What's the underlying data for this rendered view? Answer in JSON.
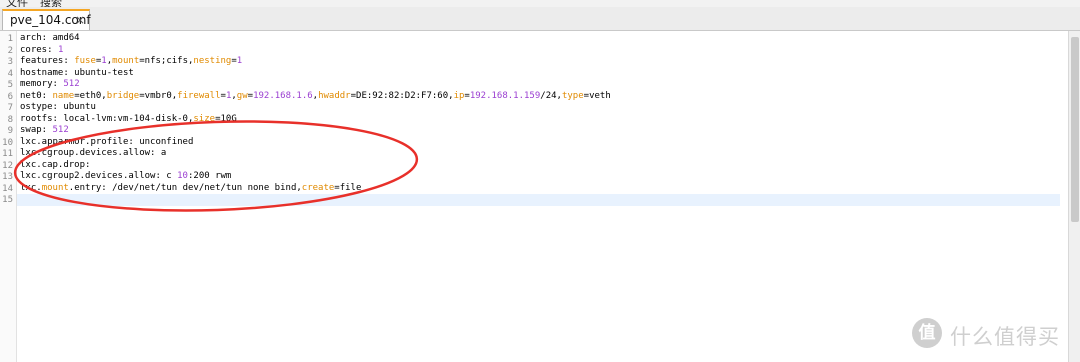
{
  "menubar": {
    "file": "文件",
    "search": "搜索"
  },
  "tab": {
    "label": "pve_104.conf",
    "close": "×"
  },
  "editor": {
    "lines": [
      {
        "n": "1",
        "segs": [
          {
            "t": "arch: amd64",
            "c": "p"
          }
        ]
      },
      {
        "n": "2",
        "segs": [
          {
            "t": "cores: ",
            "c": "p"
          },
          {
            "t": "1",
            "c": "n"
          }
        ]
      },
      {
        "n": "3",
        "segs": [
          {
            "t": "features: ",
            "c": "p"
          },
          {
            "t": "fuse",
            "c": "k"
          },
          {
            "t": "=",
            "c": "p"
          },
          {
            "t": "1",
            "c": "n"
          },
          {
            "t": ",",
            "c": "p"
          },
          {
            "t": "mount",
            "c": "k"
          },
          {
            "t": "=nfs;cifs,",
            "c": "p"
          },
          {
            "t": "nesting",
            "c": "k"
          },
          {
            "t": "=",
            "c": "p"
          },
          {
            "t": "1",
            "c": "n"
          }
        ]
      },
      {
        "n": "4",
        "segs": [
          {
            "t": "hostname: ubuntu-test",
            "c": "p"
          }
        ]
      },
      {
        "n": "5",
        "segs": [
          {
            "t": "memory: ",
            "c": "p"
          },
          {
            "t": "512",
            "c": "n"
          }
        ]
      },
      {
        "n": "6",
        "segs": [
          {
            "t": "net0: ",
            "c": "p"
          },
          {
            "t": "name",
            "c": "k"
          },
          {
            "t": "=eth0,",
            "c": "p"
          },
          {
            "t": "bridge",
            "c": "k"
          },
          {
            "t": "=vmbr0,",
            "c": "p"
          },
          {
            "t": "firewall",
            "c": "k"
          },
          {
            "t": "=",
            "c": "p"
          },
          {
            "t": "1",
            "c": "n"
          },
          {
            "t": ",",
            "c": "p"
          },
          {
            "t": "gw",
            "c": "k"
          },
          {
            "t": "=",
            "c": "p"
          },
          {
            "t": "192.168.1.6",
            "c": "n"
          },
          {
            "t": ",",
            "c": "p"
          },
          {
            "t": "hwaddr",
            "c": "k"
          },
          {
            "t": "=DE:92:82:D2:F7:60,",
            "c": "p"
          },
          {
            "t": "ip",
            "c": "k"
          },
          {
            "t": "=",
            "c": "p"
          },
          {
            "t": "192.168.1.159",
            "c": "n"
          },
          {
            "t": "/24,",
            "c": "p"
          },
          {
            "t": "type",
            "c": "k"
          },
          {
            "t": "=veth",
            "c": "p"
          }
        ]
      },
      {
        "n": "7",
        "segs": [
          {
            "t": "ostype: ubuntu",
            "c": "p"
          }
        ]
      },
      {
        "n": "8",
        "segs": [
          {
            "t": "rootfs: local-lvm:vm-104-disk-0,",
            "c": "p"
          },
          {
            "t": "size",
            "c": "k"
          },
          {
            "t": "=10G",
            "c": "p"
          }
        ]
      },
      {
        "n": "9",
        "segs": [
          {
            "t": "swap: ",
            "c": "p"
          },
          {
            "t": "512",
            "c": "n"
          }
        ]
      },
      {
        "n": "10",
        "segs": [
          {
            "t": "lxc.apparmor.profile: unconfined",
            "c": "p"
          }
        ]
      },
      {
        "n": "11",
        "segs": [
          {
            "t": "lxc.cgroup.devices.allow: a",
            "c": "p"
          }
        ]
      },
      {
        "n": "12",
        "segs": [
          {
            "t": "lxc.cap.drop:",
            "c": "p"
          }
        ]
      },
      {
        "n": "13",
        "segs": [
          {
            "t": "lxc.cgroup2.devices.allow: c ",
            "c": "p"
          },
          {
            "t": "10",
            "c": "n"
          },
          {
            "t": ":200 rwm",
            "c": "p"
          }
        ]
      },
      {
        "n": "14",
        "segs": [
          {
            "t": "lxc.",
            "c": "p"
          },
          {
            "t": "mount",
            "c": "k"
          },
          {
            "t": ".entry: /dev/net/tun dev/net/tun none bind,",
            "c": "p"
          },
          {
            "t": "create",
            "c": "k"
          },
          {
            "t": "=file",
            "c": "p"
          }
        ]
      },
      {
        "n": "15",
        "segs": []
      }
    ],
    "current_line": 15
  },
  "annotation": {
    "color": "#e8302a"
  },
  "watermark": {
    "badge": "值",
    "text": "什么值得买"
  },
  "colors": {
    "keyword": "#e08a00",
    "number": "#9b3fd1",
    "tab_accent": "#f5a623"
  }
}
